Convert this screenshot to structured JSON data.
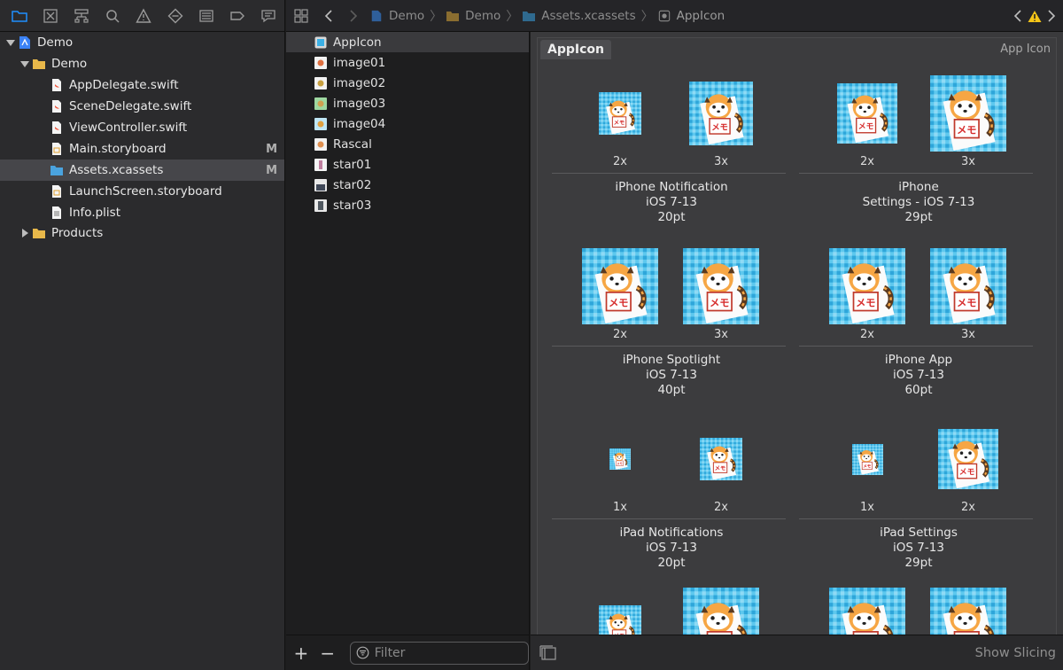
{
  "navigator": {
    "tabs": [
      "project-navigator-icon",
      "source-control-icon",
      "symbol-navigator-icon",
      "find-navigator-icon",
      "issue-navigator-icon",
      "test-navigator-icon",
      "debug-navigator-icon",
      "breakpoint-navigator-icon",
      "report-navigator-icon"
    ],
    "tree": [
      {
        "label": "Demo",
        "level": 0,
        "kind": "project",
        "expanded": true
      },
      {
        "label": "Demo",
        "level": 1,
        "kind": "folder",
        "expanded": true
      },
      {
        "label": "AppDelegate.swift",
        "level": 2,
        "kind": "swift"
      },
      {
        "label": "SceneDelegate.swift",
        "level": 2,
        "kind": "swift"
      },
      {
        "label": "ViewController.swift",
        "level": 2,
        "kind": "swift"
      },
      {
        "label": "Main.storyboard",
        "level": 2,
        "kind": "storyboard",
        "badge": "M"
      },
      {
        "label": "Assets.xcassets",
        "level": 2,
        "kind": "xcassets",
        "badge": "M",
        "selected": true
      },
      {
        "label": "LaunchScreen.storyboard",
        "level": 2,
        "kind": "storyboard"
      },
      {
        "label": "Info.plist",
        "level": 2,
        "kind": "plist"
      },
      {
        "label": "Products",
        "level": 1,
        "kind": "folder",
        "expanded": false
      }
    ]
  },
  "jumpbar": {
    "crumbs": [
      "Demo",
      "Demo",
      "Assets.xcassets",
      "AppIcon"
    ]
  },
  "assets": {
    "items": [
      {
        "label": "AppIcon",
        "selected": true
      },
      {
        "label": "image01"
      },
      {
        "label": "image02"
      },
      {
        "label": "image03"
      },
      {
        "label": "image04"
      },
      {
        "label": "Rascal"
      },
      {
        "label": "star01"
      },
      {
        "label": "star02"
      },
      {
        "label": "star03"
      }
    ],
    "add_label": "+",
    "remove_label": "−",
    "filter_placeholder": "Filter"
  },
  "editor": {
    "set_name": "AppIcon",
    "set_kind": "App Icon",
    "groups": [
      {
        "lines": [
          "iPhone Notification",
          "iOS 7-13",
          "20pt"
        ],
        "scales": [
          "2x",
          "3x"
        ]
      },
      {
        "lines": [
          "iPhone",
          "Settings - iOS 7-13",
          "29pt"
        ],
        "scales": [
          "2x",
          "3x"
        ]
      },
      {
        "lines": [
          "iPhone Spotlight",
          "iOS 7-13",
          "40pt"
        ],
        "scales": [
          "2x",
          "3x"
        ]
      },
      {
        "lines": [
          "iPhone App",
          "iOS 7-13",
          "60pt"
        ],
        "scales": [
          "2x",
          "3x"
        ]
      },
      {
        "lines": [
          "iPad Notifications",
          "iOS 7-13",
          "20pt"
        ],
        "scales": [
          "1x",
          "2x"
        ]
      },
      {
        "lines": [
          "iPad Settings",
          "iOS 7-13",
          "29pt"
        ],
        "scales": [
          "1x",
          "2x"
        ]
      }
    ],
    "show_slicing": "Show Slicing"
  },
  "colors": {
    "folder": "#e8b84a",
    "swift": "#f05138",
    "accent": "#0a84ff",
    "warning": "#f5c518"
  }
}
